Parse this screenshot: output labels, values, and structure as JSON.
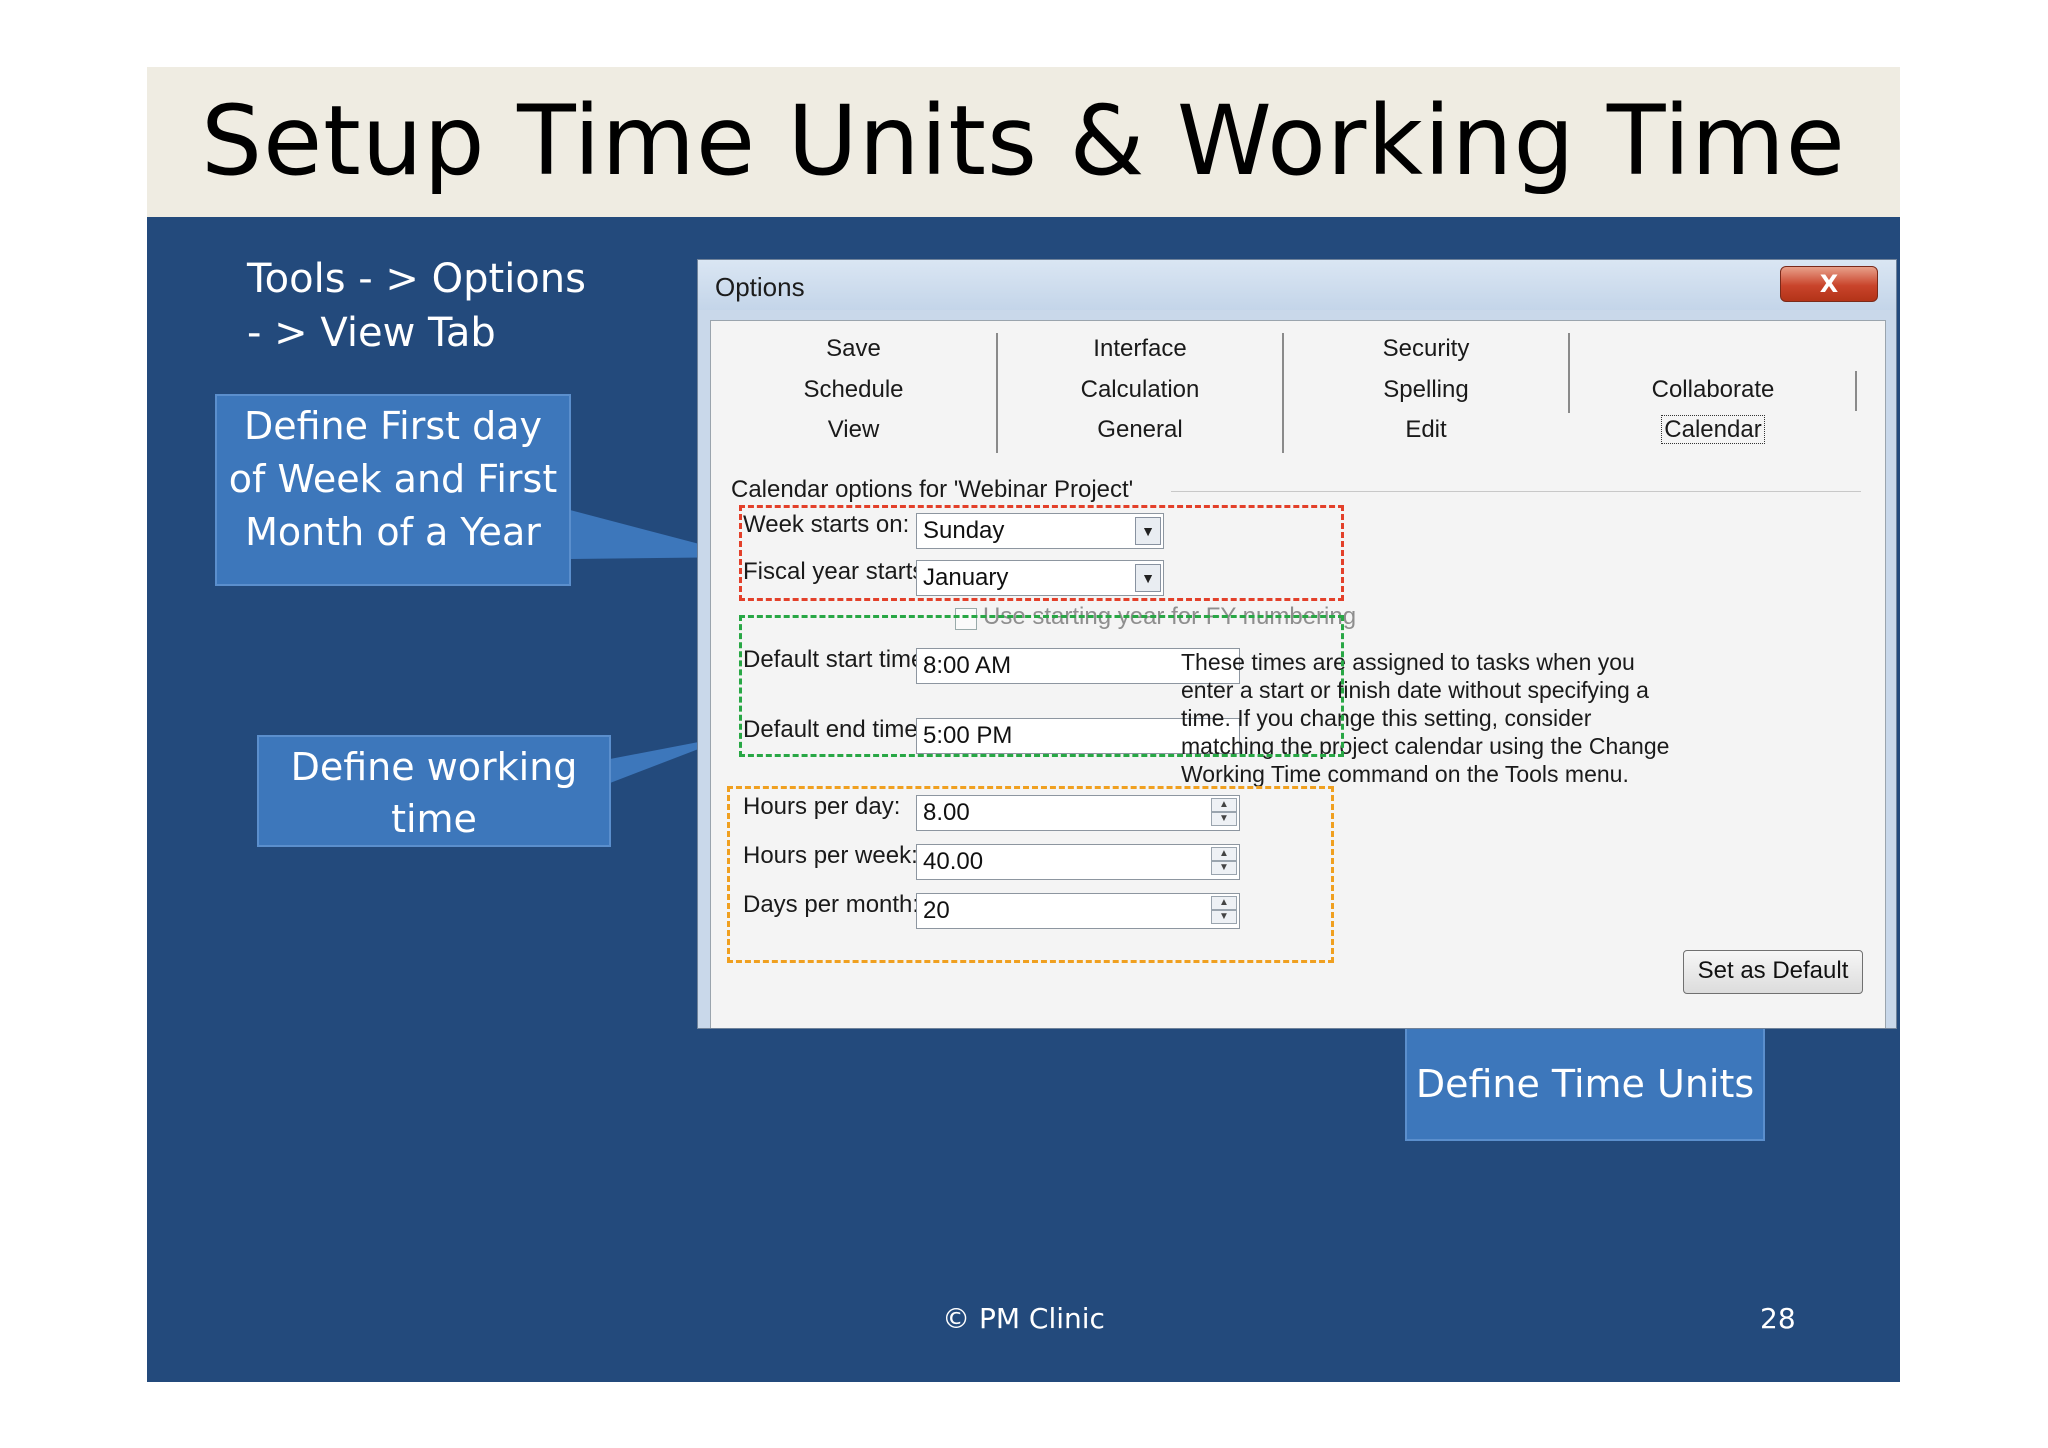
{
  "slide": {
    "title": "Setup Time Units & Working Time",
    "tools_path_line1": "Tools - > Options",
    "tools_path_line2": "- > View Tab",
    "callouts": {
      "first_day": [
        "Define First day",
        "of Week and First",
        "Month of a Year"
      ],
      "working_time": [
        "Define working",
        "time"
      ],
      "time_units": "Define Time Units"
    },
    "footer": "© PM Clinic",
    "page_number": "28"
  },
  "dialog": {
    "title": "Options",
    "close_label": "X",
    "tabs": {
      "row1": [
        "Save",
        "Interface",
        "Security"
      ],
      "row2": [
        "Schedule",
        "Calculation",
        "Spelling",
        "Collaborate"
      ],
      "row3": [
        "View",
        "General",
        "Edit",
        "Calendar"
      ]
    },
    "selected_tab": "Calendar",
    "section_header": "Calendar options for 'Webinar Project'",
    "week_starts_label": "Week starts on:",
    "week_starts_value": "Sunday",
    "fiscal_year_label": "Fiscal year starts in:",
    "fiscal_year_value": "January",
    "fy_numbering_label": "Use starting year for FY numbering",
    "default_start_label": "Default start time:",
    "default_start_value": "8:00 AM",
    "default_end_label": "Default end time:",
    "default_end_value": "5:00 PM",
    "hint_lines": [
      "These times are assigned to tasks when you",
      "enter a start or finish date without specifying a",
      "time. If you change this setting, consider",
      "matching the project calendar using the Change",
      "Working Time command on the Tools menu."
    ],
    "hours_per_day_label": "Hours per day:",
    "hours_per_day_value": "8.00",
    "hours_per_week_label": "Hours per week:",
    "hours_per_week_value": "40.00",
    "days_per_month_label": "Days per month:",
    "days_per_month_value": "20",
    "set_default_label": "Set as Default"
  },
  "colors": {
    "slide_background": "#234a7c",
    "title_band": "#efece2",
    "callout": "#3d77bb",
    "highlight_red": "#e3402a",
    "highlight_green": "#28a745",
    "highlight_orange": "#f0a020"
  }
}
